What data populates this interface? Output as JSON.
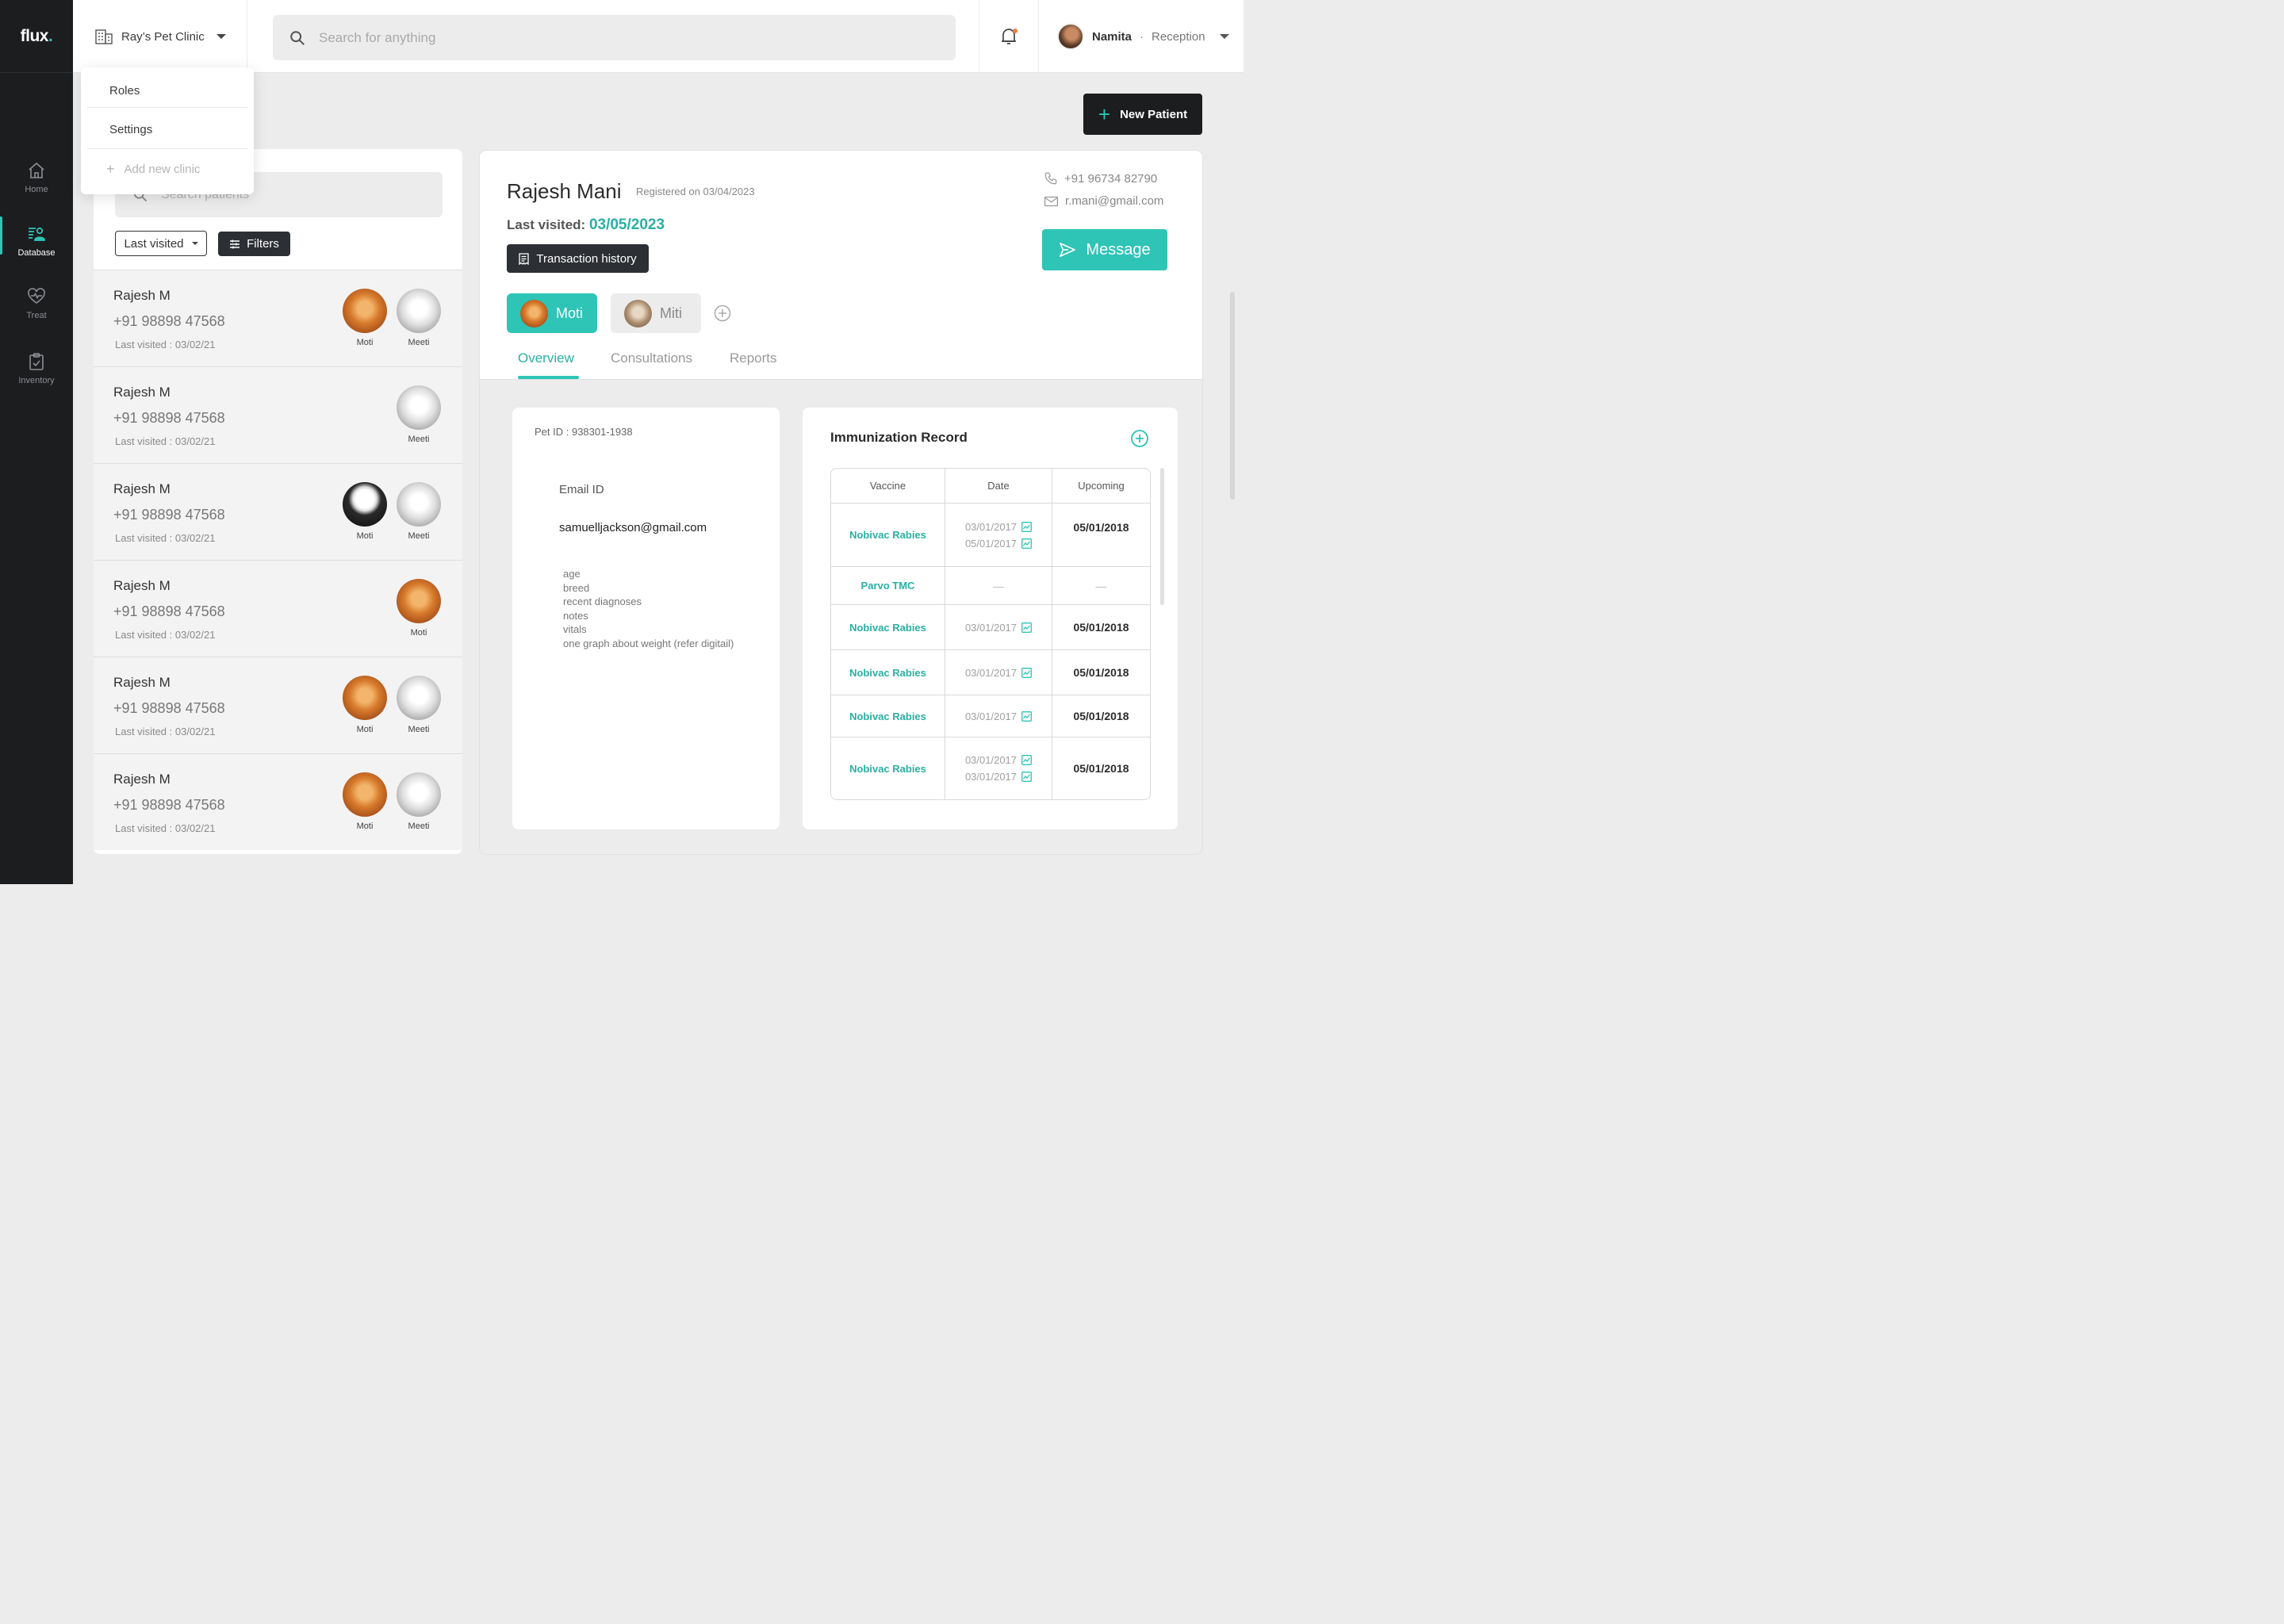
{
  "app": {
    "logo": "flux",
    "logo_dot": "."
  },
  "nav": [
    {
      "label": "Home",
      "icon": "home-icon"
    },
    {
      "label": "Database",
      "icon": "database-icon",
      "active": true
    },
    {
      "label": "Treat",
      "icon": "heart-pulse-icon"
    },
    {
      "label": "Inventory",
      "icon": "clipboard-check-icon"
    }
  ],
  "header": {
    "clinic": "Ray’s Pet Clinic",
    "search_placeholder": "Search for anything",
    "user": {
      "name": "Namita",
      "separator": "·",
      "role": "Reception"
    }
  },
  "clinic_menu": {
    "items": [
      "Roles",
      "Settings"
    ],
    "add_label": "Add new clinic"
  },
  "actions": {
    "new_patient": "New Patient"
  },
  "patient_list": {
    "search_placeholder": "Search patients",
    "sort_label": "Last visited",
    "filter_label": "Filters",
    "rows": [
      {
        "name": "Rajesh M",
        "phone": "+91 98898 47568",
        "last_visited": "Last visited : 03/02/21",
        "pets": [
          {
            "name": "Moti",
            "kind": "dog"
          },
          {
            "name": "Meeti",
            "kind": "cat"
          }
        ]
      },
      {
        "name": "Rajesh M",
        "phone": "+91 98898 47568",
        "last_visited": "Last visited : 03/02/21",
        "pets": [
          {
            "name": "Meeti",
            "kind": "cat"
          }
        ]
      },
      {
        "name": "Rajesh M",
        "phone": "+91 98898 47568",
        "last_visited": "Last visited : 03/02/21",
        "pets": [
          {
            "name": "Moti",
            "kind": "eagle"
          },
          {
            "name": "Meeti",
            "kind": "cat"
          }
        ]
      },
      {
        "name": "Rajesh M",
        "phone": "+91 98898 47568",
        "last_visited": "Last visited : 03/02/21",
        "pets": [
          {
            "name": "Moti",
            "kind": "dog"
          }
        ]
      },
      {
        "name": "Rajesh M",
        "phone": "+91 98898 47568",
        "last_visited": "Last visited : 03/02/21",
        "pets": [
          {
            "name": "Moti",
            "kind": "dog"
          },
          {
            "name": "Meeti",
            "kind": "cat"
          }
        ]
      },
      {
        "name": "Rajesh M",
        "phone": "+91 98898 47568",
        "last_visited": "Last visited : 03/02/21",
        "pets": [
          {
            "name": "Moti",
            "kind": "dog"
          },
          {
            "name": "Meeti",
            "kind": "cat"
          }
        ]
      }
    ]
  },
  "patient": {
    "name": "Rajesh Mani",
    "registered": "Registered on 03/04/2023",
    "last_visited_label": "Last visited:",
    "last_visited_date": "03/05/2023",
    "transaction_history": "Transaction history",
    "phone": "+91 96734 82790",
    "email": "r.mani@gmail.com",
    "message": "Message",
    "pets": [
      {
        "name": "Moti",
        "kind": "dog",
        "active": true
      },
      {
        "name": "Miti",
        "kind": "dog"
      }
    ],
    "tabs": [
      "Overview",
      "Consultations",
      "Reports"
    ]
  },
  "overview": {
    "pet_id": "Pet ID : 938301-1938",
    "email_label": "Email ID",
    "email_value": "samuelljackson@gmail.com",
    "notes": [
      "age",
      "breed",
      "recent diagnoses",
      "notes",
      "vitals",
      "one graph about weight (refer digitail)"
    ]
  },
  "immunization": {
    "title": "Immunization Record",
    "columns": [
      "Vaccine",
      "Date",
      "Upcoming"
    ],
    "rows": [
      {
        "vaccine": "Nobivac Rabies",
        "dates": [
          "03/01/2017",
          "05/01/2017"
        ],
        "upcoming": "05/01/2018"
      },
      {
        "vaccine": "Parvo TMC",
        "dates": [],
        "upcoming": "",
        "empty": "—"
      },
      {
        "vaccine": "Nobivac Rabies",
        "dates": [
          "03/01/2017"
        ],
        "upcoming": "05/01/2018"
      },
      {
        "vaccine": "Nobivac Rabies",
        "dates": [
          "03/01/2017"
        ],
        "upcoming": "05/01/2018"
      },
      {
        "vaccine": "Nobivac Rabies",
        "dates": [
          "03/01/2017"
        ],
        "upcoming": "05/01/2018"
      },
      {
        "vaccine": "Nobivac Rabies",
        "dates": [
          "03/01/2017",
          "03/01/2017"
        ],
        "upcoming": "05/01/2018"
      }
    ]
  },
  "colors": {
    "accent": "#2ec4b6",
    "sidebar": "#1b1d1f",
    "background": "#ececec",
    "notification": "#f07b3f"
  }
}
